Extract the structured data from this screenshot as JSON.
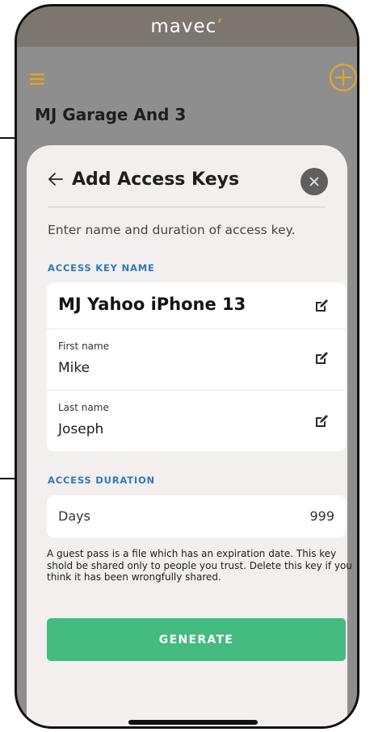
{
  "app": {
    "logo_main": "mavec",
    "logo_accent": "’",
    "home_title": "MJ Garage And 3"
  },
  "sheet": {
    "title": "Add Access Keys",
    "intro": "Enter name and duration of access key.",
    "name_section_label": "ACCESS KEY NAME",
    "key_name": "MJ Yahoo iPhone 13",
    "first_name_label": "First name",
    "first_name_value": "Mike",
    "last_name_label": "Last name",
    "last_name_value": "Joseph",
    "duration_section_label": "ACCESS DURATION",
    "duration_unit": "Days",
    "duration_value": "999",
    "note": "A guest pass is a file which has an expiration date. This key shold be shared only to people you trust. Delete this key if you think it has been wrongfully shared.",
    "generate_label": "GENERATE"
  },
  "icons": {
    "menu": "hamburger-menu-icon",
    "add": "plus-circle-icon",
    "back": "arrow-left-icon",
    "close": "close-icon",
    "edit": "edit-square-icon"
  },
  "colors": {
    "accent_orange": "#e0a52a",
    "section_blue": "#2d7bbd",
    "generate_green": "#44bb7f",
    "sheet_bg": "#f3efee",
    "overlay_grey": "#8e8e8e"
  }
}
